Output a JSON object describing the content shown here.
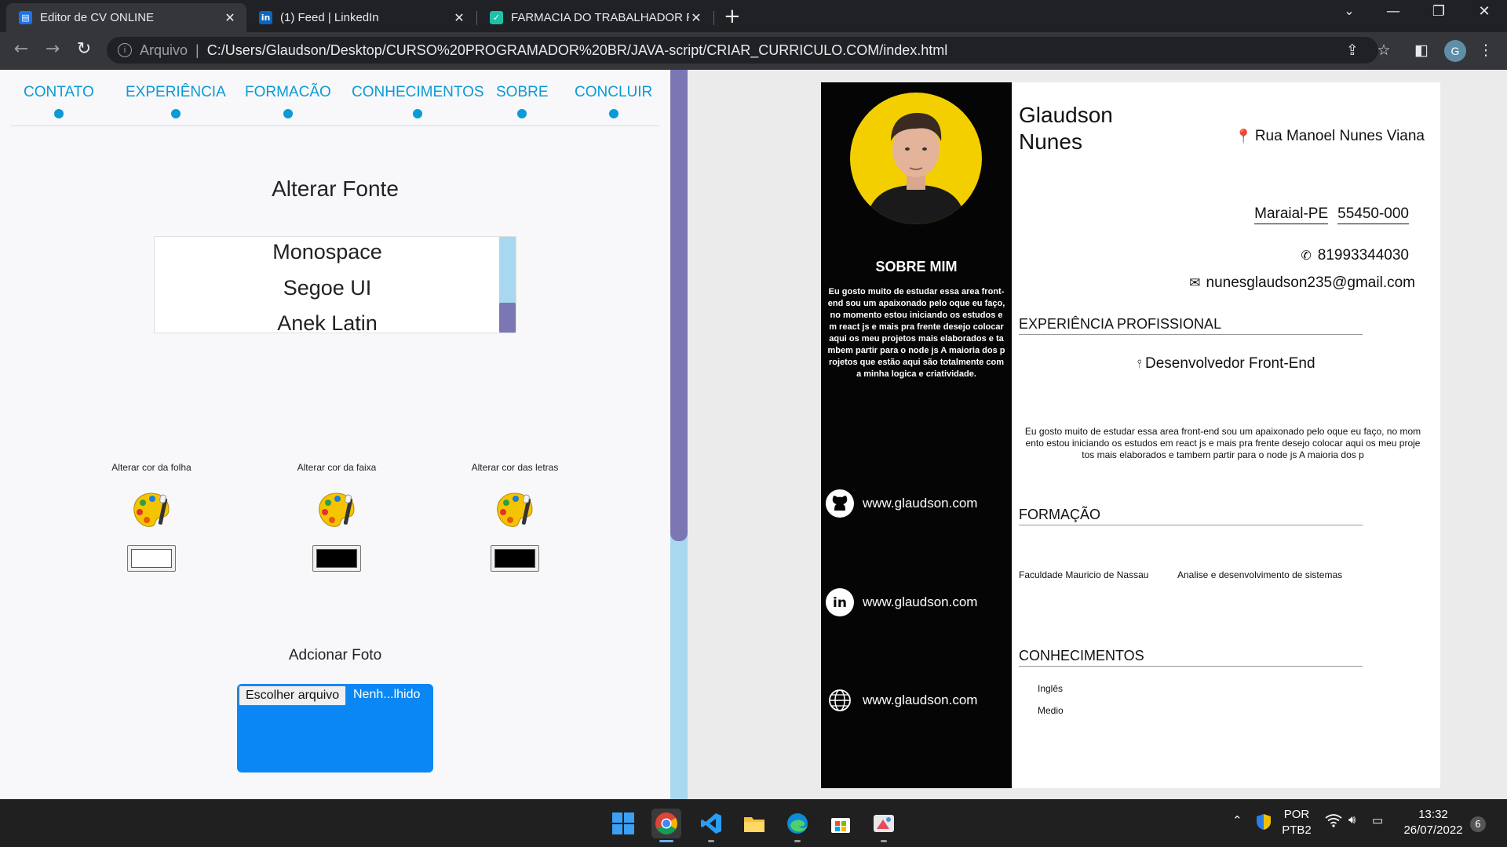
{
  "browser": {
    "tabs": [
      {
        "title": "Editor de CV ONLINE",
        "favicon": "document-icon",
        "active": true
      },
      {
        "title": "(1) Feed | LinkedIn",
        "favicon": "linkedin-icon",
        "active": false
      },
      {
        "title": "FARMACIA DO TRABALHADOR R",
        "favicon": "check-icon",
        "active": false
      }
    ],
    "address": {
      "scheme_label": "Arquivo",
      "url": "C:/Users/Glaudson/Desktop/CURSO%20PROGRAMADOR%20BR/JAVA-script/CRIAR_CURRICULO.COM/index.html"
    },
    "profile_initial": "G"
  },
  "editor": {
    "steps": [
      "CONTATO",
      "EXPERIÊNCIA",
      "FORMACÃO",
      "CONHECIMENTOS",
      "SOBRE",
      "CONCLUIR"
    ],
    "font_section": {
      "title": "Alterar Fonte",
      "options": [
        "Monospace",
        "Segoe UI",
        "Anek Latin"
      ]
    },
    "colors": [
      {
        "label": "Alterar cor da folha",
        "value": "#ffffff"
      },
      {
        "label": "Alterar cor da faixa",
        "value": "#000000"
      },
      {
        "label": "Alterar cor das letras",
        "value": "#000000"
      }
    ],
    "photo": {
      "title": "Adcionar Foto",
      "button_label": "Escolher arquivo",
      "file_status": "Nenh...lhido"
    }
  },
  "cv": {
    "first_name": "Glaudson",
    "last_name": "Nunes",
    "address": "Rua Manoel Nunes Viana",
    "city": "Maraial-PE",
    "zip": "55450-000",
    "phone": "81993344030",
    "email": "nunesglaudson235@gmail.com",
    "about_title": "SOBRE MIM",
    "about_text": "Eu gosto muito de estudar essa area front-end sou um apaixonado pelo oque eu faço, no momento estou iniciando os estudos em react js e mais pra frente desejo colocar aqui os meu projetos mais elaborados e tambem partir para o node js A maioria dos projetos que estão aqui são totalmente com a minha logica e criatividade.",
    "social": [
      {
        "icon": "github-icon",
        "text": "www.glaudson.com"
      },
      {
        "icon": "linkedin-icon",
        "text": "www.glaudson.com"
      },
      {
        "icon": "globe-icon",
        "text": "www.glaudson.com"
      }
    ],
    "experience_title": "EXPERIÊNCIA PROFISSIONAL",
    "job_title": "Desenvolvedor Front-End",
    "job_description": "Eu gosto muito de estudar essa area front-end sou um apaixonado pelo oque eu faço, no momento estou iniciando os estudos em react js e mais pra frente desejo colocar aqui os meu projetos mais elaborados e tambem partir para o node js A maioria dos p",
    "education_title": "FORMAÇÃO",
    "school": "Faculdade Mauricio de Nassau",
    "course": "Analise e desenvolvimento de sistemas",
    "skills_title": "CONHECIMENTOS",
    "skill": "Inglês",
    "skill_level": "Medio"
  },
  "taskbar": {
    "language": "POR",
    "layout": "PTB2",
    "time": "13:32",
    "date": "26/07/2022",
    "notifications": "6"
  },
  "colors": {
    "accent": "#0a9bd6",
    "scroll_track": "#a8d8ef",
    "scroll_thumb": "#7b76b4",
    "upload_box": "#0a87f5"
  }
}
